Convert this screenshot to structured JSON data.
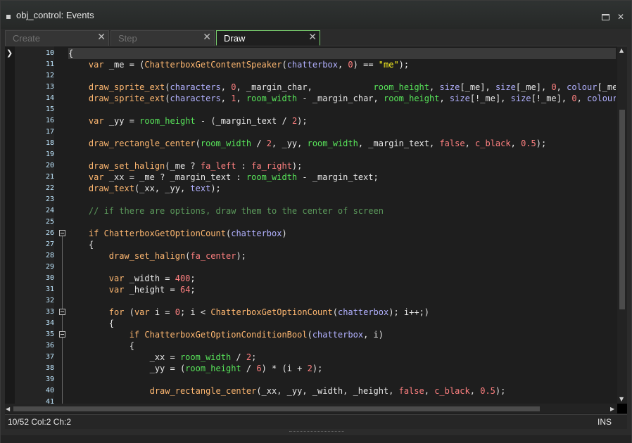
{
  "window": {
    "title": "obj_control: Events"
  },
  "tabs": [
    {
      "label": "Create",
      "active": false
    },
    {
      "label": "Step",
      "active": false
    },
    {
      "label": "Draw",
      "active": true
    }
  ],
  "editor": {
    "lines": [
      {
        "num": "10",
        "tokens": [
          [
            "o",
            "{"
          ]
        ]
      },
      {
        "num": "11",
        "tokens": [
          [
            "o",
            "    "
          ],
          [
            "k",
            "var"
          ],
          [
            "o",
            " _me = ("
          ],
          [
            "f",
            "ChatterboxGetContentSpeaker"
          ],
          [
            "o",
            "("
          ],
          [
            "v",
            "chatterbox"
          ],
          [
            "o",
            ", "
          ],
          [
            "n",
            "0"
          ],
          [
            "o",
            ") == "
          ],
          [
            "s",
            "\"me\""
          ],
          [
            "o",
            ");"
          ]
        ]
      },
      {
        "num": "12",
        "tokens": []
      },
      {
        "num": "13",
        "tokens": [
          [
            "o",
            "    "
          ],
          [
            "f",
            "draw_sprite_ext"
          ],
          [
            "o",
            "("
          ],
          [
            "v",
            "characters"
          ],
          [
            "o",
            ", "
          ],
          [
            "n",
            "0"
          ],
          [
            "o",
            ", _margin_char,            "
          ],
          [
            "b",
            "room_height"
          ],
          [
            "o",
            ", "
          ],
          [
            "v",
            "size"
          ],
          [
            "o",
            "[_me], "
          ],
          [
            "v",
            "size"
          ],
          [
            "o",
            "[_me], "
          ],
          [
            "n",
            "0"
          ],
          [
            "o",
            ", "
          ],
          [
            "v",
            "colour"
          ],
          [
            "o",
            "[_me],"
          ]
        ]
      },
      {
        "num": "14",
        "tokens": [
          [
            "o",
            "    "
          ],
          [
            "f",
            "draw_sprite_ext"
          ],
          [
            "o",
            "("
          ],
          [
            "v",
            "characters"
          ],
          [
            "o",
            ", "
          ],
          [
            "n",
            "1"
          ],
          [
            "o",
            ", "
          ],
          [
            "b",
            "room_width"
          ],
          [
            "o",
            " - _margin_char, "
          ],
          [
            "b",
            "room_height"
          ],
          [
            "o",
            ", "
          ],
          [
            "v",
            "size"
          ],
          [
            "o",
            "[!_me], "
          ],
          [
            "v",
            "size"
          ],
          [
            "o",
            "[!_me], "
          ],
          [
            "n",
            "0"
          ],
          [
            "o",
            ", "
          ],
          [
            "v",
            "colour"
          ],
          [
            "o",
            "[!_"
          ]
        ]
      },
      {
        "num": "15",
        "tokens": []
      },
      {
        "num": "16",
        "tokens": [
          [
            "o",
            "    "
          ],
          [
            "k",
            "var"
          ],
          [
            "o",
            " _yy = "
          ],
          [
            "b",
            "room_height"
          ],
          [
            "o",
            " - (_margin_text / "
          ],
          [
            "n",
            "2"
          ],
          [
            "o",
            ");"
          ]
        ]
      },
      {
        "num": "17",
        "tokens": []
      },
      {
        "num": "18",
        "tokens": [
          [
            "o",
            "    "
          ],
          [
            "f",
            "draw_rectangle_center"
          ],
          [
            "o",
            "("
          ],
          [
            "b",
            "room_width"
          ],
          [
            "o",
            " / "
          ],
          [
            "n",
            "2"
          ],
          [
            "o",
            ", _yy, "
          ],
          [
            "b",
            "room_width"
          ],
          [
            "o",
            ", _margin_text, "
          ],
          [
            "n",
            "false"
          ],
          [
            "o",
            ", "
          ],
          [
            "n",
            "c_black"
          ],
          [
            "o",
            ", "
          ],
          [
            "n",
            "0.5"
          ],
          [
            "o",
            ");"
          ]
        ]
      },
      {
        "num": "19",
        "tokens": []
      },
      {
        "num": "20",
        "tokens": [
          [
            "o",
            "    "
          ],
          [
            "f",
            "draw_set_halign"
          ],
          [
            "o",
            "(_me ? "
          ],
          [
            "n",
            "fa_left"
          ],
          [
            "o",
            " : "
          ],
          [
            "n",
            "fa_right"
          ],
          [
            "o",
            ");"
          ]
        ]
      },
      {
        "num": "21",
        "tokens": [
          [
            "o",
            "    "
          ],
          [
            "k",
            "var"
          ],
          [
            "o",
            " _xx = _me ? _margin_text : "
          ],
          [
            "b",
            "room_width"
          ],
          [
            "o",
            " - _margin_text;"
          ]
        ]
      },
      {
        "num": "22",
        "tokens": [
          [
            "o",
            "    "
          ],
          [
            "f",
            "draw_text"
          ],
          [
            "o",
            "(_xx, _yy, "
          ],
          [
            "v",
            "text"
          ],
          [
            "o",
            ");"
          ]
        ]
      },
      {
        "num": "23",
        "tokens": []
      },
      {
        "num": "24",
        "tokens": [
          [
            "o",
            "    "
          ],
          [
            "c",
            "// if there are options, draw them to the center of screen"
          ]
        ]
      },
      {
        "num": "25",
        "tokens": []
      },
      {
        "num": "26",
        "tokens": [
          [
            "o",
            "    "
          ],
          [
            "k",
            "if"
          ],
          [
            "o",
            " "
          ],
          [
            "f",
            "ChatterboxGetOptionCount"
          ],
          [
            "o",
            "("
          ],
          [
            "v",
            "chatterbox"
          ],
          [
            "o",
            ")"
          ]
        ]
      },
      {
        "num": "27",
        "tokens": [
          [
            "o",
            "    {"
          ]
        ]
      },
      {
        "num": "28",
        "tokens": [
          [
            "o",
            "        "
          ],
          [
            "f",
            "draw_set_halign"
          ],
          [
            "o",
            "("
          ],
          [
            "n",
            "fa_center"
          ],
          [
            "o",
            ");"
          ]
        ]
      },
      {
        "num": "29",
        "tokens": []
      },
      {
        "num": "30",
        "tokens": [
          [
            "o",
            "        "
          ],
          [
            "k",
            "var"
          ],
          [
            "o",
            " _width = "
          ],
          [
            "n",
            "400"
          ],
          [
            "o",
            ";"
          ]
        ]
      },
      {
        "num": "31",
        "tokens": [
          [
            "o",
            "        "
          ],
          [
            "k",
            "var"
          ],
          [
            "o",
            " _height = "
          ],
          [
            "n",
            "64"
          ],
          [
            "o",
            ";"
          ]
        ]
      },
      {
        "num": "32",
        "tokens": []
      },
      {
        "num": "33",
        "tokens": [
          [
            "o",
            "        "
          ],
          [
            "k",
            "for"
          ],
          [
            "o",
            " ("
          ],
          [
            "k",
            "var"
          ],
          [
            "o",
            " i = "
          ],
          [
            "n",
            "0"
          ],
          [
            "o",
            "; i < "
          ],
          [
            "f",
            "ChatterboxGetOptionCount"
          ],
          [
            "o",
            "("
          ],
          [
            "v",
            "chatterbox"
          ],
          [
            "o",
            "); i++;)"
          ]
        ]
      },
      {
        "num": "34",
        "tokens": [
          [
            "o",
            "        {"
          ]
        ]
      },
      {
        "num": "35",
        "tokens": [
          [
            "o",
            "            "
          ],
          [
            "k",
            "if"
          ],
          [
            "o",
            " "
          ],
          [
            "f",
            "ChatterboxGetOptionConditionBool"
          ],
          [
            "o",
            "("
          ],
          [
            "v",
            "chatterbox"
          ],
          [
            "o",
            ", i)"
          ]
        ]
      },
      {
        "num": "36",
        "tokens": [
          [
            "o",
            "            {"
          ]
        ]
      },
      {
        "num": "37",
        "tokens": [
          [
            "o",
            "                _xx = "
          ],
          [
            "b",
            "room_width"
          ],
          [
            "o",
            " / "
          ],
          [
            "n",
            "2"
          ],
          [
            "o",
            ";"
          ]
        ]
      },
      {
        "num": "38",
        "tokens": [
          [
            "o",
            "                _yy = ("
          ],
          [
            "b",
            "room_height"
          ],
          [
            "o",
            " / "
          ],
          [
            "n",
            "6"
          ],
          [
            "o",
            ") * (i + "
          ],
          [
            "n",
            "2"
          ],
          [
            "o",
            ");"
          ]
        ]
      },
      {
        "num": "39",
        "tokens": []
      },
      {
        "num": "40",
        "tokens": [
          [
            "o",
            "                "
          ],
          [
            "f",
            "draw_rectangle_center"
          ],
          [
            "o",
            "(_xx, _yy, _width, _height, "
          ],
          [
            "n",
            "false"
          ],
          [
            "o",
            ", "
          ],
          [
            "n",
            "c_black"
          ],
          [
            "o",
            ", "
          ],
          [
            "n",
            "0.5"
          ],
          [
            "o",
            ");"
          ]
        ]
      },
      {
        "num": "41",
        "tokens": []
      }
    ],
    "fold_lines": [
      "26",
      "33",
      "35"
    ]
  },
  "status": {
    "position": "10/52 Col:2 Ch:2",
    "mode": "INS"
  },
  "colors": {
    "active_tab_border": "#7ad16f",
    "line_numbers": "#bfe7ff",
    "keyword": "#ffb871",
    "variable": "#b2b1ff",
    "number": "#ff8080",
    "string": "#fcf320",
    "comment": "#5b995b",
    "builtin": "#58e55a"
  }
}
